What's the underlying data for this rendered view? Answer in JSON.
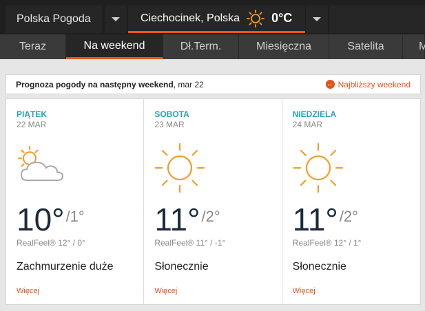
{
  "topbar": {
    "site": "Polska Pogoda",
    "location": "Ciechocinek, Polska",
    "temperature": "0°C"
  },
  "nav": {
    "tabs": [
      {
        "label": "Teraz",
        "active": false
      },
      {
        "label": "Na weekend",
        "active": true
      },
      {
        "label": "Dł.Term.",
        "active": false
      },
      {
        "label": "Miesięczna",
        "active": false
      },
      {
        "label": "Satelita",
        "active": false
      },
      {
        "label": "M",
        "active": false
      }
    ]
  },
  "header": {
    "title_bold": "Prognoza pogody na następny weekend",
    "title_rest": ", mar 22",
    "link": "Najbliższy weekend"
  },
  "days": [
    {
      "day": "PIĄTEK",
      "date": "22 MAR",
      "icon": "partly-cloudy-icon",
      "hi": "10°",
      "lo": "/1°",
      "realfeel": "RealFeel® 12° / 0°",
      "desc": "Zachmurzenie duże",
      "more": "Więcej"
    },
    {
      "day": "SOBOTA",
      "date": "23 MAR",
      "icon": "sun-icon",
      "hi": "11°",
      "lo": "/2°",
      "realfeel": "RealFeel® 11° / -1°",
      "desc": "Słonecznie",
      "more": "Więcej"
    },
    {
      "day": "NIEDZIELA",
      "date": "24 MAR",
      "icon": "sun-icon",
      "hi": "11°",
      "lo": "/2°",
      "realfeel": "RealFeel® 12° / 1°",
      "desc": "Słonecznie",
      "more": "Więcej"
    }
  ]
}
